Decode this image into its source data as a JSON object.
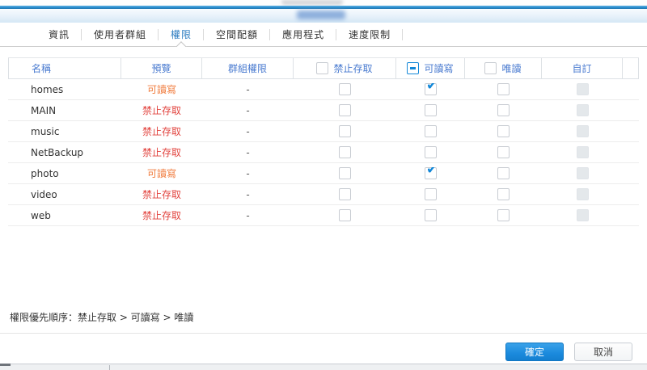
{
  "tabs": [
    {
      "id": "info",
      "label": "資訊",
      "selected": false
    },
    {
      "id": "user-groups",
      "label": "使用者群組",
      "selected": false
    },
    {
      "id": "permissions",
      "label": "權限",
      "selected": true
    },
    {
      "id": "quota",
      "label": "空間配額",
      "selected": false
    },
    {
      "id": "applications",
      "label": "應用程式",
      "selected": false
    },
    {
      "id": "speed-limit",
      "label": "速度限制",
      "selected": false
    }
  ],
  "table": {
    "columns": {
      "name": "名稱",
      "preview": "預覽",
      "group": "群組權限",
      "no_access": "禁止存取",
      "read_write": "可讀寫",
      "read_only": "唯讀",
      "custom": "自訂"
    },
    "header_checkboxes": {
      "no_access": "unchecked",
      "read_write": "indeterminate",
      "read_only": "unchecked"
    },
    "rows": [
      {
        "name": "homes",
        "preview": "可讀寫",
        "preview_state": "rw",
        "group": "-",
        "no_access": false,
        "read_write": true,
        "read_only": false,
        "custom": "disabled"
      },
      {
        "name": "MAIN",
        "preview": "禁止存取",
        "preview_state": "na",
        "group": "-",
        "no_access": false,
        "read_write": false,
        "read_only": false,
        "custom": "disabled"
      },
      {
        "name": "music",
        "preview": "禁止存取",
        "preview_state": "na",
        "group": "-",
        "no_access": false,
        "read_write": false,
        "read_only": false,
        "custom": "disabled"
      },
      {
        "name": "NetBackup",
        "preview": "禁止存取",
        "preview_state": "na",
        "group": "-",
        "no_access": false,
        "read_write": false,
        "read_only": false,
        "custom": "disabled"
      },
      {
        "name": "photo",
        "preview": "可讀寫",
        "preview_state": "rw",
        "group": "-",
        "no_access": false,
        "read_write": true,
        "read_only": false,
        "custom": "disabled"
      },
      {
        "name": "video",
        "preview": "禁止存取",
        "preview_state": "na",
        "group": "-",
        "no_access": false,
        "read_write": false,
        "read_only": false,
        "custom": "disabled"
      },
      {
        "name": "web",
        "preview": "禁止存取",
        "preview_state": "na",
        "group": "-",
        "no_access": false,
        "read_write": false,
        "read_only": false,
        "custom": "disabled"
      }
    ]
  },
  "footer": {
    "priority_note": "權限優先順序：禁止存取 > 可讀寫 > 唯讀"
  },
  "buttons": {
    "ok": "確定",
    "cancel": "取消"
  },
  "colors": {
    "accent_blue": "#1488d8",
    "header_text_blue": "#4a7bd0",
    "tab_selected_blue": "#2d7dc1",
    "read_write_orange": "#f07b3c",
    "no_access_red": "#e2433e"
  }
}
